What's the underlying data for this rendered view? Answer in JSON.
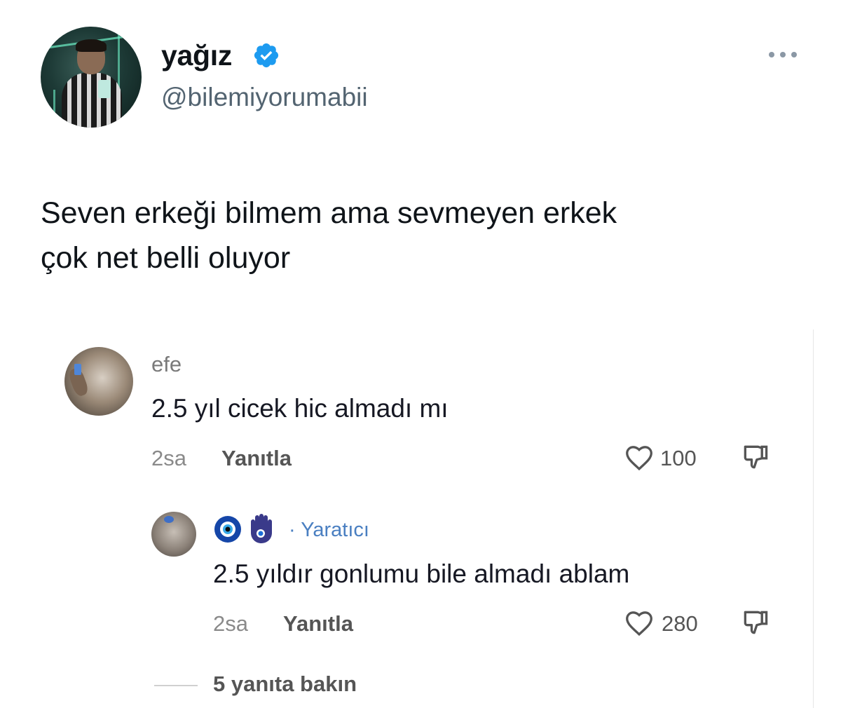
{
  "tweet": {
    "display_name": "yağız",
    "handle": "@bilemiyorumabii",
    "verified": true,
    "text_line1": "Seven erkeği bilmem ama sevmeyen erkek",
    "text_line2": "çok net belli oluyor",
    "menu_icon": "more-icon"
  },
  "comments": {
    "first": {
      "username": "efe",
      "text": "2.5 yıl cicek hic almadı mı",
      "time": "2sa",
      "reply_label": "Yanıtla",
      "likes": "100"
    },
    "reply": {
      "username_icons": [
        "nazar-icon",
        "hamsa-icon"
      ],
      "badge": "· Yaratıcı",
      "text": "2.5 yıldır gonlumu bile almadı ablam",
      "time": "2sa",
      "reply_label": "Yanıtla",
      "likes": "280"
    },
    "view_more": "5 yanıta bakın"
  },
  "colors": {
    "text": "#0f1419",
    "muted": "#536471",
    "verified": "#1d9bf0",
    "creator": "#4a7fc1"
  }
}
